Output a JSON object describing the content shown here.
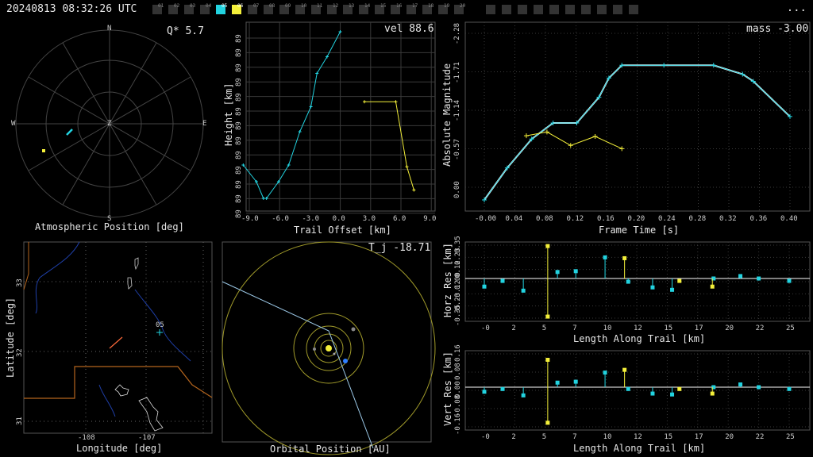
{
  "header": {
    "timestamp": "20240813 08:32:26 UTC",
    "menu": "...",
    "station_tabs": [
      "01",
      "02",
      "03",
      "04",
      "05",
      "06",
      "07",
      "08",
      "09",
      "10",
      "11",
      "12",
      "13",
      "14",
      "15",
      "16",
      "17",
      "18",
      "19",
      "20"
    ],
    "active_tab_cyan": "05",
    "active_tab_yellow": "06"
  },
  "polar": {
    "title": "Atmospheric Position [deg]",
    "readout": "Q*  5.7",
    "dirs": {
      "n": "N",
      "s": "S",
      "e": "E",
      "w": "W",
      "z": "Z"
    }
  },
  "height_plot": {
    "readout": "vel 88.6",
    "xlabel": "Trail Offset [km]",
    "ylabel": "Height [km]",
    "xticks": [
      "-9.0",
      "-6.0",
      "-3.0",
      "0.0",
      "3.0",
      "6.0",
      "9.0"
    ],
    "yticks": [
      "89",
      "89",
      "89",
      "89",
      "89",
      "89",
      "89",
      "89",
      "89",
      "89",
      "89",
      "89",
      "89"
    ]
  },
  "mag_plot": {
    "readout": "mass -3.00",
    "xlabel": "Frame Time [s]",
    "ylabel": "Absolute Magnitude",
    "xticks": [
      "-0.00",
      "0.04",
      "0.08",
      "0.12",
      "0.16",
      "0.20",
      "0.24",
      "0.28",
      "0.32",
      "0.36",
      "0.40"
    ],
    "yticks": [
      "-2.28",
      "-1.71",
      "-1.14",
      "-0.57",
      "0.00"
    ]
  },
  "map_plot": {
    "xlabel": "Longitude [deg]",
    "ylabel": "Latitude [deg]",
    "xticks": [
      "-108",
      "-107"
    ],
    "yticks": [
      "33",
      "32",
      "31"
    ],
    "station_label": "05"
  },
  "orbit_plot": {
    "readout": "T_j -18.71",
    "xlabel": "Orbital Position [AU]"
  },
  "horz_res": {
    "xlabel": "Length Along Trail [km]",
    "ylabel": "Horz Res [km]",
    "xticks": [
      "-0",
      "2",
      "5",
      "7",
      "10",
      "12",
      "15",
      "17",
      "20",
      "22",
      "25"
    ],
    "yticks": [
      "0.35",
      "0.23",
      "0.12",
      "0.00",
      "-0.12",
      "-0.23",
      "-0.35"
    ]
  },
  "vert_res": {
    "xlabel": "Length Along Trail [km]",
    "ylabel": "Vert Res [km]",
    "xticks": [
      "-0",
      "2",
      "5",
      "7",
      "10",
      "12",
      "15",
      "17",
      "20",
      "22",
      "25"
    ],
    "yticks": [
      "0.16",
      "0.08",
      "0.00",
      "-0.08",
      "-0.16"
    ]
  },
  "colors": {
    "cyan": "#22d3e0",
    "yellow": "#f4f03a",
    "white": "#ffffff",
    "grid": "#3a3a3a"
  },
  "chart_data": [
    {
      "type": "line",
      "panel": "height",
      "series": [
        {
          "color": "cyan",
          "x": [
            -9.6,
            -8.3,
            -7.6,
            -7.3,
            -6.1,
            -5.1,
            -4.0,
            -2.9,
            -2.3,
            -1.3,
            0.0
          ],
          "y": [
            0.2,
            0.1,
            0.0,
            0.0,
            0.1,
            0.2,
            0.4,
            0.55,
            0.75,
            0.85,
            1.0
          ]
        },
        {
          "color": "yellow",
          "x": [
            2.4,
            5.5,
            6.6,
            7.3
          ],
          "y": [
            0.58,
            0.58,
            0.19,
            0.05
          ]
        }
      ]
    },
    {
      "type": "line",
      "panel": "magnitude",
      "series": [
        {
          "color": "cyan",
          "x": [
            0.0,
            0.03,
            0.062,
            0.09,
            0.121,
            0.15,
            0.163,
            0.18,
            0.235,
            0.3,
            0.338,
            0.352,
            0.4
          ],
          "y": [
            0.0,
            -0.5,
            -0.95,
            -1.2,
            -1.2,
            -1.6,
            -1.9,
            -2.1,
            -2.1,
            -2.1,
            -1.96,
            -1.85,
            -1.3
          ]
        },
        {
          "color": "yellow",
          "x": [
            0.055,
            0.082,
            0.113,
            0.145,
            0.18
          ],
          "y": [
            -1.0,
            -1.06,
            -0.85,
            -0.99,
            -0.8
          ]
        }
      ]
    },
    {
      "type": "scatter",
      "panel": "horz_res",
      "series": [
        {
          "color": "cyan",
          "x": [
            0.0,
            1.5,
            3.2,
            6.0,
            7.5,
            9.9,
            11.8,
            13.8,
            15.4,
            18.8,
            21.0,
            22.5,
            25.0
          ],
          "y": [
            -0.1,
            -0.03,
            -0.15,
            0.08,
            0.09,
            0.26,
            -0.04,
            -0.11,
            -0.14,
            0.0,
            0.03,
            0.0,
            -0.03
          ]
        },
        {
          "color": "yellow",
          "x": [
            5.2,
            5.2,
            11.5,
            16.0,
            18.7
          ],
          "y": [
            0.4,
            -0.47,
            0.25,
            -0.03,
            -0.1
          ]
        }
      ]
    },
    {
      "type": "scatter",
      "panel": "vert_res",
      "series": [
        {
          "color": "cyan",
          "x": [
            0.0,
            1.5,
            3.2,
            6.0,
            7.5,
            9.9,
            11.8,
            13.8,
            15.4,
            18.8,
            21.0,
            22.5,
            25.0
          ],
          "y": [
            -0.05,
            -0.02,
            -0.09,
            0.05,
            0.06,
            0.16,
            -0.02,
            -0.07,
            -0.08,
            0.0,
            0.03,
            0.0,
            -0.02
          ]
        },
        {
          "color": "yellow",
          "x": [
            5.2,
            5.2,
            11.5,
            16.0,
            18.7
          ],
          "y": [
            0.3,
            -0.39,
            0.19,
            -0.02,
            -0.07
          ]
        }
      ]
    }
  ]
}
